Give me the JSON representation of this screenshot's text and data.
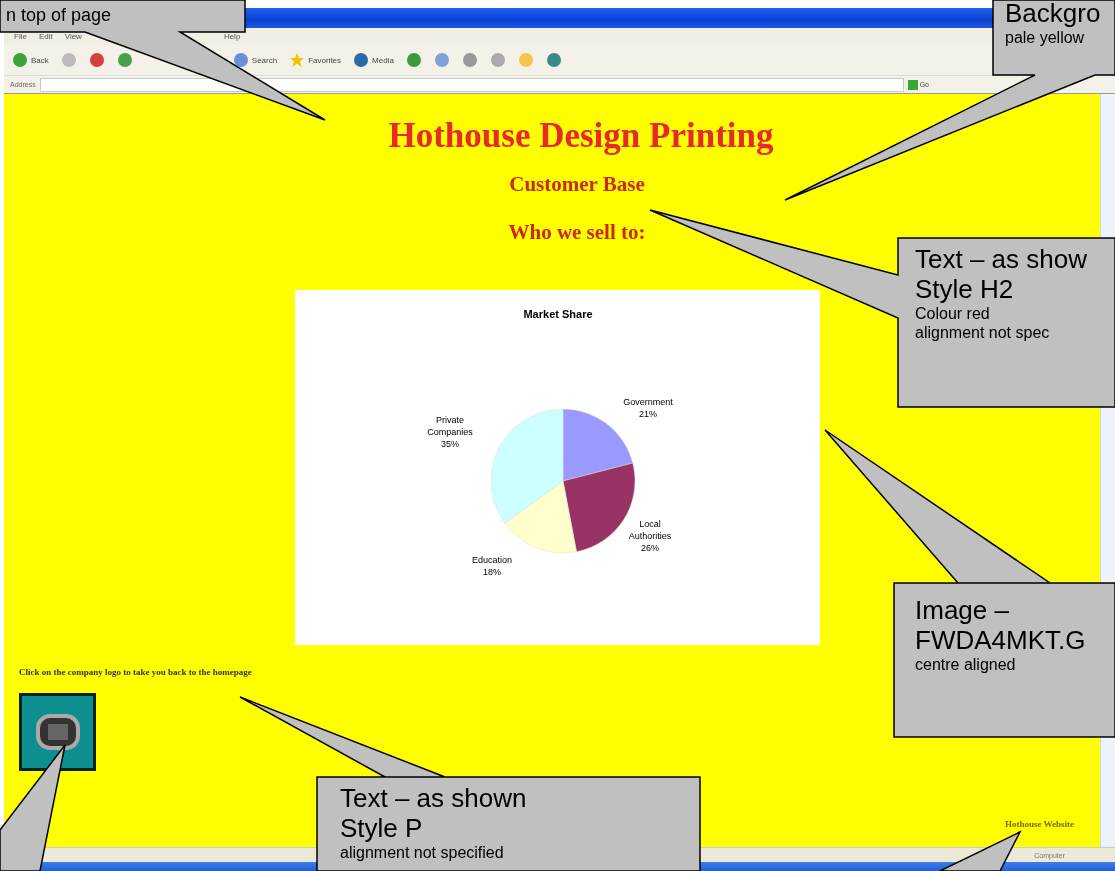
{
  "menu": [
    {
      "label": "File"
    },
    {
      "label": "Edit"
    },
    {
      "label": "View"
    },
    {
      "label": "Help"
    }
  ],
  "toolbar": [
    {
      "kind": "back",
      "label": "Back"
    },
    {
      "kind": "forward"
    },
    {
      "kind": "stop"
    },
    {
      "kind": "refresh"
    },
    {
      "kind": "search",
      "label": "Search"
    },
    {
      "kind": "favorites",
      "label": "Favorites"
    },
    {
      "kind": "media",
      "label": "Media"
    },
    {
      "kind": "history"
    },
    {
      "kind": "mail"
    },
    {
      "kind": "print"
    },
    {
      "kind": "edit"
    },
    {
      "kind": "folder"
    },
    {
      "kind": "messenger"
    }
  ],
  "address_bar": {
    "label": "Address",
    "go": "Go"
  },
  "page": {
    "title": "Hothouse Design Printing",
    "subtitle": "Customer Base",
    "tagline": "Who we sell to:",
    "chart_data": {
      "type": "pie",
      "title": "Market Share",
      "categories": [
        "Government",
        "Local Authorities",
        "Education",
        "Private Companies"
      ],
      "series": [
        {
          "values": [
            21,
            26,
            18,
            35
          ]
        }
      ],
      "value_labels": [
        "21%",
        "26%",
        "18%",
        "35%"
      ]
    },
    "paragraph": "Click on the company logo to take you back to the homepage",
    "footer_link": "Hothouse Website"
  },
  "status_bar": {
    "zone": "Computer"
  },
  "callouts": [
    {
      "lines": [
        {
          "kind": "big",
          "text": "n top of page"
        }
      ]
    },
    {
      "lines": [
        {
          "kind": "big",
          "text": "Backgro"
        },
        {
          "kind": "small",
          "text": "pale yellow"
        }
      ]
    },
    {
      "lines": [
        {
          "kind": "big",
          "text": "Text – as show"
        },
        {
          "kind": "big",
          "text": "Style H2"
        },
        {
          "kind": "small",
          "text": "Colour red"
        },
        {
          "kind": "small",
          "text": "alignment not spec"
        }
      ]
    },
    {
      "lines": [
        {
          "kind": "big",
          "text": "Image –"
        },
        {
          "kind": "big",
          "text": "FWDA4MKT.G"
        },
        {
          "kind": "small",
          "text": "centre aligned"
        }
      ]
    },
    {
      "lines": [
        {
          "kind": "big",
          "text": "Text – as shown"
        },
        {
          "kind": "big",
          "text": "Style P"
        },
        {
          "kind": "small",
          "text": "alignment not specified"
        }
      ]
    }
  ]
}
